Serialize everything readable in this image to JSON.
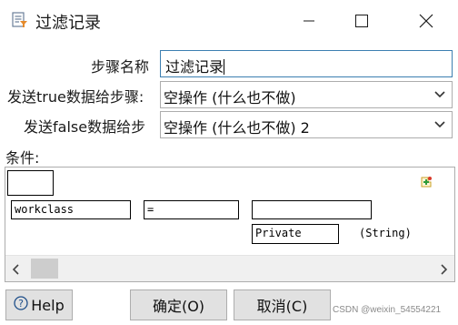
{
  "window": {
    "title": "过滤记录",
    "icon": "filter-rows-icon"
  },
  "form": {
    "step_name_label": "步骤名称",
    "step_name_value": "过滤记录",
    "true_label": "发送true数据给步骤:",
    "true_value": "空操作 (什么也不做)",
    "false_label": "发送false数据给步",
    "false_value": "空操作 (什么也不做) 2",
    "conditions_label": "条件:"
  },
  "condition": {
    "field": "workclass",
    "operator": "=",
    "value": "Private",
    "value_type": "(String)"
  },
  "buttons": {
    "help": "Help",
    "ok": "确定(O)",
    "cancel": "取消(C)"
  },
  "watermark": "CSDN @weixin_54554221",
  "colors": {
    "accent_border": "#3c7fb1",
    "button_bg": "#e1e1e1"
  }
}
